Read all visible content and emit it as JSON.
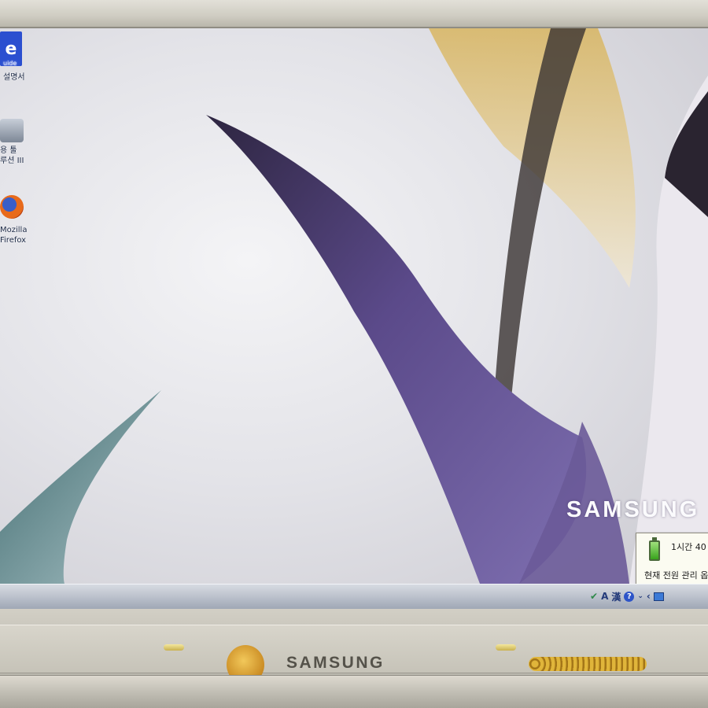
{
  "desktop": {
    "icons": [
      {
        "glyph": "e",
        "label": "설명서",
        "icon": "e-guide-icon"
      },
      {
        "glyph": "",
        "label": "용 툴\n루션 III",
        "icon": "toolbox-icon"
      },
      {
        "glyph": "",
        "label": "Mozilla\nFirefox",
        "icon": "firefox-icon"
      }
    ],
    "guide_badge": "uide"
  },
  "wallpaper": {
    "brand": "SAMSUNG"
  },
  "power_popup": {
    "time_left": "1시간 40",
    "scheme": "현재 전원 관리 옵"
  },
  "taskbar": {
    "tray": {
      "ime_lang": "A",
      "ime_hanja": "漢",
      "help": "?",
      "expand": "‹"
    }
  },
  "bezel": {
    "brand": "SAMSUNG"
  },
  "colors": {
    "accent_purple": "#5b4a8a",
    "taskbar": "#b9bfca",
    "bezel": "#c6c3b8"
  }
}
